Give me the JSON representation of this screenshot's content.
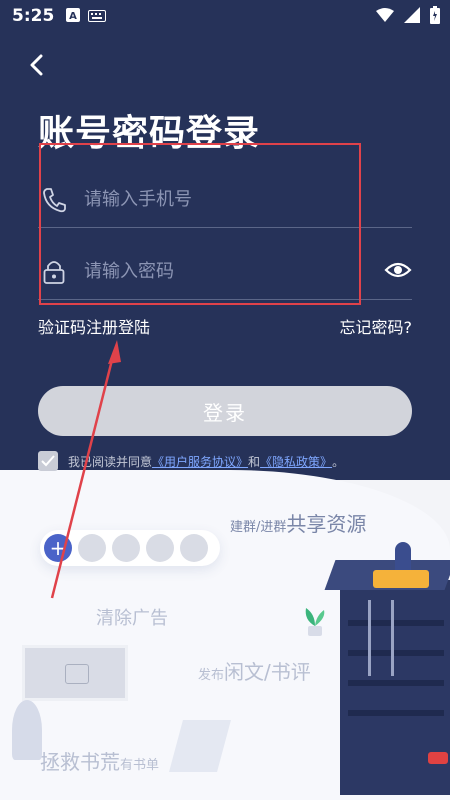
{
  "status_bar": {
    "time": "5:25",
    "left_icons": [
      "a-box-icon",
      "keyboard-icon"
    ],
    "right_icons": [
      "wifi-icon",
      "signal-icon",
      "battery-icon"
    ]
  },
  "header": {
    "title": "账号密码登录"
  },
  "form": {
    "phone_placeholder": "请输入手机号",
    "password_placeholder": "请输入密码"
  },
  "links": {
    "sms_register": "验证码注册登陆",
    "forgot_password": "忘记密码?"
  },
  "login_button": "登录",
  "agreement": {
    "prefix": "我已阅读并同意",
    "user_agreement": "《用户服务协议》",
    "and": "和",
    "privacy_policy": "《隐私政策》",
    "suffix": "。"
  },
  "promos": {
    "share_small": "建群/进群",
    "share_big": "共享资源",
    "ads": "清除广告",
    "discuss_small": "发布",
    "discuss_big": "闲文/书评",
    "rescue_big": "拯救书荒",
    "rescue_small": "有书单"
  },
  "colors": {
    "hero_bg": "#263259",
    "highlight_red": "#e0424a",
    "link_blue": "#7fa7ff",
    "button_gray": "#d2d4db"
  }
}
